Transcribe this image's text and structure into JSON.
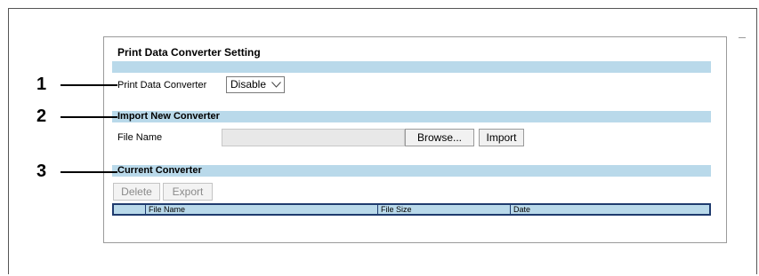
{
  "panel": {
    "title": "Print Data Converter Setting"
  },
  "converter_setting": {
    "label": "Print Data Converter",
    "selected": "Disable",
    "icon": "chevron-down-icon"
  },
  "import_section": {
    "title": "Import New Converter",
    "file_label": "File Name",
    "browse_label": "Browse...",
    "import_label": "Import"
  },
  "current_section": {
    "title": "Current Converter",
    "delete_label": "Delete",
    "export_label": "Export",
    "columns": [
      "File Name",
      "File Size",
      "Date"
    ]
  },
  "callouts": [
    "1",
    "2",
    "3"
  ],
  "colors": {
    "section_bar": "#b9d9ea",
    "table_border": "#1f3b6e"
  }
}
